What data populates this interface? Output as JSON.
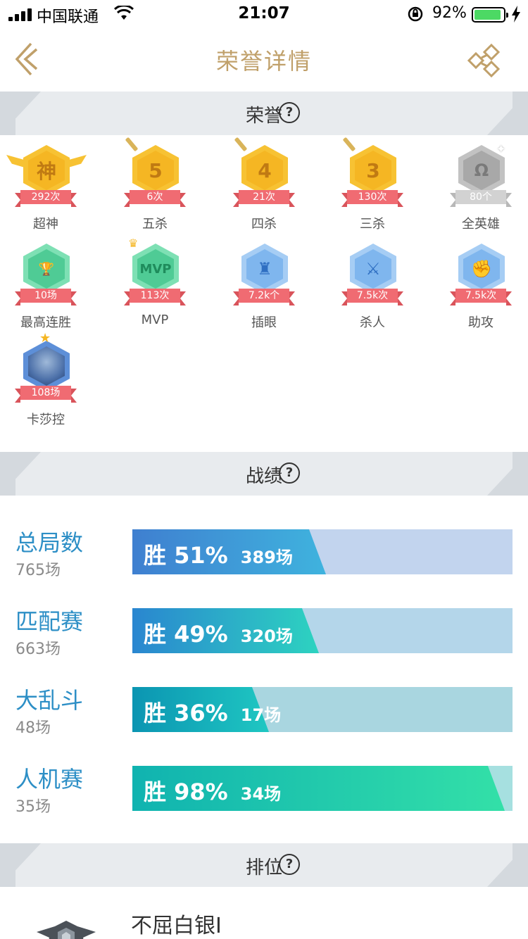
{
  "status_bar": {
    "carrier": "中国联通",
    "time": "21:07",
    "battery_percent": "92%",
    "battery_level": 0.92,
    "battery_color": "#4cd964"
  },
  "nav": {
    "title": "荣誉详情",
    "back_icon": "back-arrow-icon",
    "share_icon": "share-icon",
    "accent_color": "#c0a06a"
  },
  "sections": {
    "honors": {
      "title": "荣誉",
      "help_icon": "?"
    },
    "record": {
      "title": "战绩",
      "help_icon": "?"
    },
    "rank": {
      "title": "排位",
      "help_icon": "?"
    }
  },
  "honors": [
    {
      "name": "超神",
      "value": "292次",
      "glyph": "神",
      "style": "gold",
      "icon": "godlike-badge-icon"
    },
    {
      "name": "五杀",
      "value": "6次",
      "glyph": "5",
      "style": "gold",
      "icon": "penta-kill-badge-icon"
    },
    {
      "name": "四杀",
      "value": "21次",
      "glyph": "4",
      "style": "gold",
      "icon": "quadra-kill-badge-icon"
    },
    {
      "name": "三杀",
      "value": "130次",
      "glyph": "3",
      "style": "gold",
      "icon": "triple-kill-badge-icon"
    },
    {
      "name": "全英雄",
      "value": "80个",
      "glyph": "Ω",
      "style": "gray",
      "icon": "all-heroes-badge-icon"
    },
    {
      "name": "最高连胜",
      "value": "10场",
      "glyph": "🏆",
      "style": "green",
      "icon": "win-streak-badge-icon"
    },
    {
      "name": "MVP",
      "value": "113次",
      "glyph": "MVP",
      "style": "green",
      "icon": "mvp-badge-icon"
    },
    {
      "name": "插眼",
      "value": "7.2k个",
      "glyph": "♜",
      "style": "blue",
      "icon": "ward-badge-icon"
    },
    {
      "name": "杀人",
      "value": "7.5k次",
      "glyph": "⚔",
      "style": "blue",
      "icon": "kills-badge-icon"
    },
    {
      "name": "助攻",
      "value": "7.5k次",
      "glyph": "✊",
      "style": "blue",
      "icon": "assists-badge-icon"
    },
    {
      "name": "卡莎控",
      "value": "108场",
      "glyph": "",
      "style": "avatar",
      "icon": "kaisa-champion-badge-icon"
    }
  ],
  "record": [
    {
      "mode": "总局数",
      "total": "765场",
      "win_label": "胜 51%",
      "games": "389场",
      "win_rate": 0.51,
      "fill_to": 0.51,
      "grad_from": "#3f7fd0",
      "grad_to": "#3fb3de",
      "track": "#c2d4ee"
    },
    {
      "mode": "匹配赛",
      "total": "663场",
      "win_label": "胜 49%",
      "games": "320场",
      "win_rate": 0.49,
      "fill_to": 0.49,
      "grad_from": "#2a86d0",
      "grad_to": "#2dd3c0",
      "track": "#b4d6ea"
    },
    {
      "mode": "大乱斗",
      "total": "48场",
      "win_label": "胜 36%",
      "games": "17场",
      "win_rate": 0.36,
      "fill_to": 0.36,
      "grad_from": "#0b95b2",
      "grad_to": "#1fc7c2",
      "track": "#a9d6e0"
    },
    {
      "mode": "人机赛",
      "total": "35场",
      "win_label": "胜 98%",
      "games": "34场",
      "win_rate": 0.98,
      "fill_to": 0.98,
      "grad_from": "#10b3b0",
      "grad_to": "#33e0a8",
      "track": "#a6e0e0"
    }
  ],
  "rank": {
    "tier": "不屈白银I",
    "emblem": "silver-rank-emblem-icon"
  }
}
